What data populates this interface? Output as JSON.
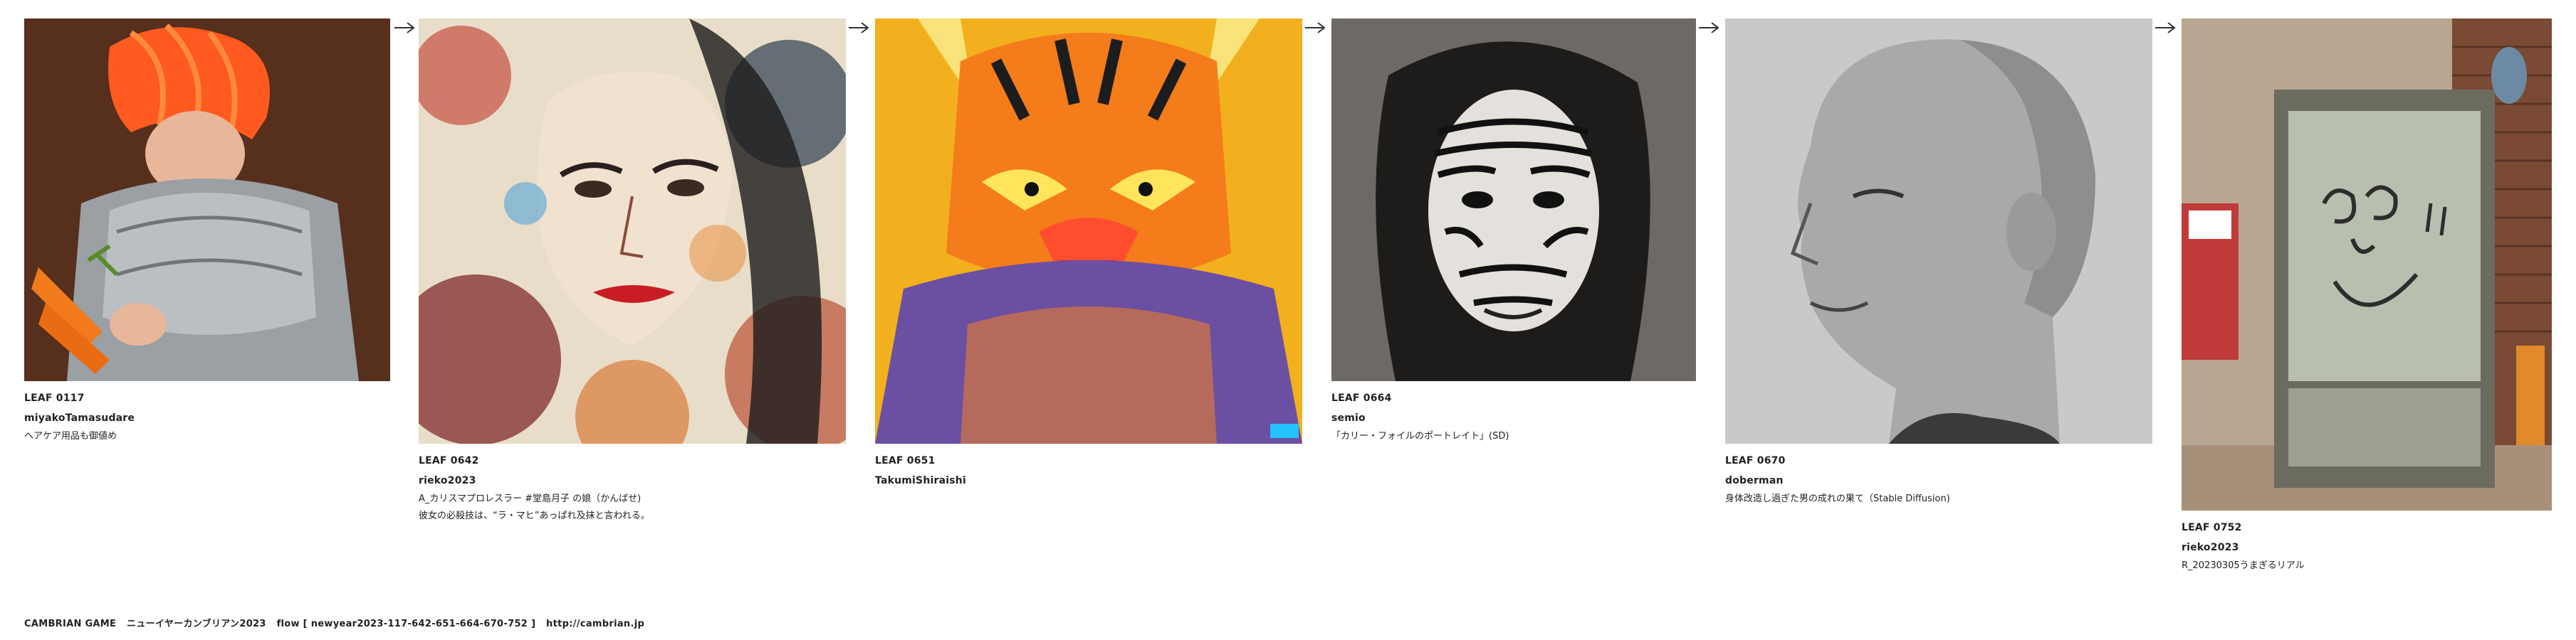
{
  "leaves": [
    {
      "id": "LEAF 0117",
      "author": "miyakoTamasudare",
      "caption": "ヘアケア用品も御値め"
    },
    {
      "id": "LEAF 0642",
      "author": "rieko2023",
      "caption": "A_カリスマプロレスラー #堂島月子 の娘（かんばせ)\n彼女の必殺技は、“ラ・マヒ”あっぱれ及抹と言われる。"
    },
    {
      "id": "LEAF 0651",
      "author": "TakumiShiraishi",
      "caption": ""
    },
    {
      "id": "LEAF 0664",
      "author": "semio",
      "caption": "「カリー・フォイルのポートレイト」(SD)"
    },
    {
      "id": "LEAF 0670",
      "author": "doberman",
      "caption": "身体改造し過ぎた男の成れの果て（Stable Diffusion)"
    },
    {
      "id": "LEAF 0752",
      "author": "rieko2023",
      "caption": "R_20230305うまぎるリアル"
    }
  ],
  "arrow_icon": "right-arrow-icon",
  "footer": {
    "game": "CAMBRIAN GAME",
    "title": "ニューイヤーカンブリアン2023",
    "flow": "flow [ newyear2023-117-642-651-664-670-752 ]",
    "url": "http://cambrian.jp"
  }
}
